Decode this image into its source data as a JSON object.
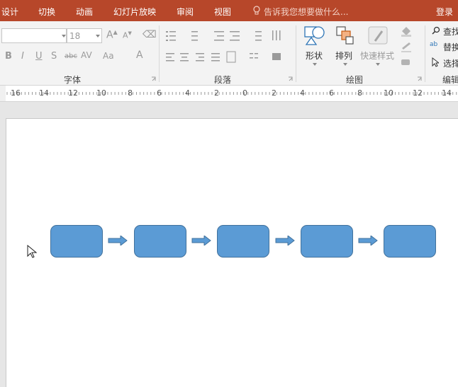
{
  "tabs": [
    "设计",
    "切换",
    "动画",
    "幻灯片放映",
    "审阅",
    "视图"
  ],
  "tell_me": "告诉我您想要做什么...",
  "login": "登录",
  "font": {
    "name_value": "",
    "size_value": "18",
    "group_label": "字体"
  },
  "paragraph": {
    "group_label": "段落"
  },
  "drawing": {
    "shapes_label": "形状",
    "arrange_label": "排列",
    "quick_styles_label": "快速样式",
    "group_label": "绘图"
  },
  "editing": {
    "find_label": "查找",
    "replace_label": "替换",
    "select_label": "选择",
    "group_label": "编辑"
  },
  "ruler": {
    "numbers": [
      "16",
      "14",
      "12",
      "10",
      "8",
      "6",
      "4",
      "2",
      "0",
      "2",
      "4",
      "6",
      "8",
      "10",
      "12",
      "14"
    ]
  },
  "slide": {
    "flow_boxes": 5,
    "flow_arrows": 4,
    "shape_fill": "#5b9bd5",
    "shape_border": "#41719c"
  },
  "colors": {
    "accent": "#b7472a",
    "ribbon_bg": "#f3f3f3"
  }
}
